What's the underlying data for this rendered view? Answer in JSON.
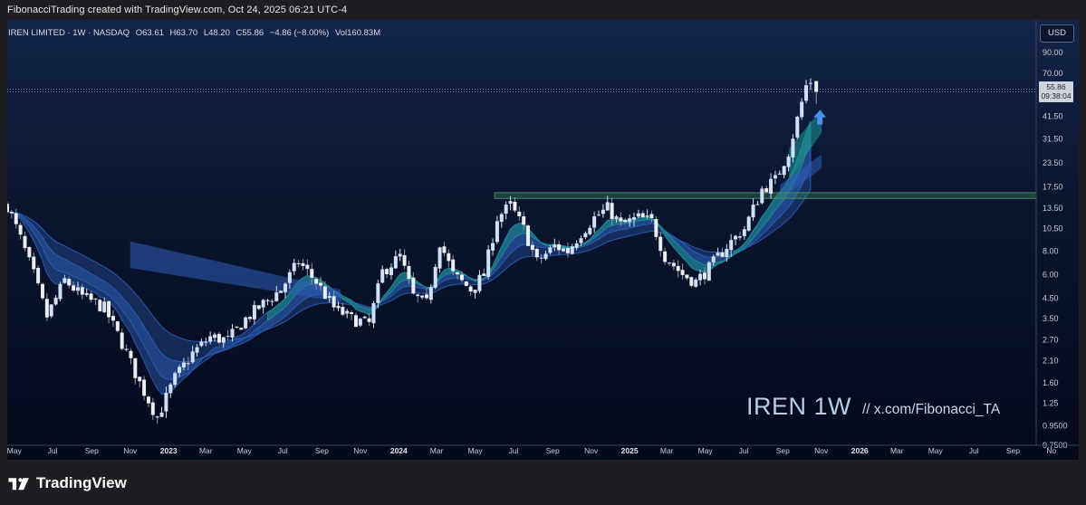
{
  "caption": "FibonacciTrading created with TradingView.com, Oct 24, 2025 06:21 UTC-4",
  "header": {
    "symbol": "IREN LIMITED · 1W · NASDAQ",
    "open": "O63.61",
    "high": "H63.70",
    "low": "L48.20",
    "close": "C55.86",
    "change": "−4.86 (−8.00%)",
    "volume": "Vol160.83M"
  },
  "currency": "USD",
  "price_label": {
    "price": "55.86",
    "countdown": "09:38:04"
  },
  "watermark": {
    "ticker": "IREN 1W",
    "handle": "//  x.com/Fibonacci_TA"
  },
  "brand": {
    "name": "TradingView",
    "icon": "tradingview-logo-icon"
  },
  "colors": {
    "candle_up": "#cfe0f7",
    "candle_down": "#8f97ab",
    "ribbon_blue": "#2e5fb8",
    "ribbon_teal": "#1c8c8f",
    "resistance": "#3f8f62",
    "arrow": "#4a8fe8",
    "axis_text": "#c7cbd6"
  },
  "chart_data": {
    "type": "candlestick",
    "interval": "1W",
    "y_scale": "log",
    "ylim": [
      0.7,
      110
    ],
    "xlim": [
      "2022-04-20",
      "2026-12-10"
    ],
    "y_ticks": [
      "90.00",
      "70.00",
      "41.50",
      "31.50",
      "23.50",
      "17.50",
      "13.50",
      "10.50",
      "8.00",
      "6.00",
      "4.50",
      "3.50",
      "2.70",
      "2.10",
      "1.60",
      "1.25",
      "0.9500",
      "0.7500"
    ],
    "x_ticks": [
      {
        "date": "2022-05-01",
        "label": "May",
        "bold": false
      },
      {
        "date": "2022-07-01",
        "label": "Jul",
        "bold": false
      },
      {
        "date": "2022-09-01",
        "label": "Sep",
        "bold": false
      },
      {
        "date": "2022-11-01",
        "label": "Nov",
        "bold": false
      },
      {
        "date": "2023-01-01",
        "label": "2023",
        "bold": true
      },
      {
        "date": "2023-03-01",
        "label": "Mar",
        "bold": false
      },
      {
        "date": "2023-05-01",
        "label": "May",
        "bold": false
      },
      {
        "date": "2023-07-01",
        "label": "Jul",
        "bold": false
      },
      {
        "date": "2023-09-01",
        "label": "Sep",
        "bold": false
      },
      {
        "date": "2023-11-01",
        "label": "Nov",
        "bold": false
      },
      {
        "date": "2024-01-01",
        "label": "2024",
        "bold": true
      },
      {
        "date": "2024-03-01",
        "label": "Mar",
        "bold": false
      },
      {
        "date": "2024-05-01",
        "label": "May",
        "bold": false
      },
      {
        "date": "2024-07-01",
        "label": "Jul",
        "bold": false
      },
      {
        "date": "2024-09-01",
        "label": "Sep",
        "bold": false
      },
      {
        "date": "2024-11-01",
        "label": "Nov",
        "bold": false
      },
      {
        "date": "2025-01-01",
        "label": "2025",
        "bold": true
      },
      {
        "date": "2025-03-01",
        "label": "Mar",
        "bold": false
      },
      {
        "date": "2025-05-01",
        "label": "May",
        "bold": false
      },
      {
        "date": "2025-07-01",
        "label": "Jul",
        "bold": false
      },
      {
        "date": "2025-09-01",
        "label": "Sep",
        "bold": false
      },
      {
        "date": "2025-11-01",
        "label": "Nov",
        "bold": false
      },
      {
        "date": "2026-01-01",
        "label": "2026",
        "bold": true
      },
      {
        "date": "2026-03-01",
        "label": "Mar",
        "bold": false
      },
      {
        "date": "2026-05-01",
        "label": "May",
        "bold": false
      },
      {
        "date": "2026-07-01",
        "label": "Jul",
        "bold": false
      },
      {
        "date": "2026-09-01",
        "label": "Sep",
        "bold": false
      },
      {
        "date": "2026-11-01",
        "label": "No",
        "bold": false
      }
    ],
    "close_anchors": [
      [
        "2022-04-20",
        14.0
      ],
      [
        "2022-05-10",
        9.5
      ],
      [
        "2022-06-01",
        6.0
      ],
      [
        "2022-06-22",
        3.6
      ],
      [
        "2022-07-20",
        5.6
      ],
      [
        "2022-08-17",
        4.6
      ],
      [
        "2022-09-21",
        4.0
      ],
      [
        "2022-10-19",
        2.6
      ],
      [
        "2022-11-16",
        1.6
      ],
      [
        "2022-12-14",
        1.05
      ],
      [
        "2023-01-11",
        1.7
      ],
      [
        "2023-02-08",
        2.3
      ],
      [
        "2023-03-08",
        2.8
      ],
      [
        "2023-04-05",
        2.7
      ],
      [
        "2023-05-03",
        3.5
      ],
      [
        "2023-05-31",
        4.2
      ],
      [
        "2023-06-28",
        5.0
      ],
      [
        "2023-07-26",
        7.0
      ],
      [
        "2023-08-23",
        5.5
      ],
      [
        "2023-09-20",
        4.0
      ],
      [
        "2023-10-18",
        3.5
      ],
      [
        "2023-11-15",
        3.3
      ],
      [
        "2023-12-06",
        6.2
      ],
      [
        "2024-01-03",
        7.5
      ],
      [
        "2024-01-24",
        4.6
      ],
      [
        "2024-02-14",
        4.2
      ],
      [
        "2024-03-06",
        9.0
      ],
      [
        "2024-03-27",
        6.0
      ],
      [
        "2024-04-24",
        5.0
      ],
      [
        "2024-05-15",
        6.0
      ],
      [
        "2024-06-05",
        12.0
      ],
      [
        "2024-06-26",
        14.0
      ],
      [
        "2024-07-17",
        10.5
      ],
      [
        "2024-08-07",
        7.0
      ],
      [
        "2024-09-04",
        8.5
      ],
      [
        "2024-09-25",
        8.0
      ],
      [
        "2024-10-16",
        10.0
      ],
      [
        "2024-11-06",
        12.0
      ],
      [
        "2024-11-27",
        13.5
      ],
      [
        "2024-12-18",
        11.0
      ],
      [
        "2025-01-15",
        12.0
      ],
      [
        "2025-02-05",
        11.5
      ],
      [
        "2025-02-26",
        7.5
      ],
      [
        "2025-03-26",
        6.0
      ],
      [
        "2025-04-16",
        5.5
      ],
      [
        "2025-05-07",
        6.5
      ],
      [
        "2025-06-04",
        8.5
      ],
      [
        "2025-07-02",
        10.5
      ],
      [
        "2025-07-30",
        17.0
      ],
      [
        "2025-08-20",
        19.0
      ],
      [
        "2025-09-10",
        27.0
      ],
      [
        "2025-09-24",
        40.0
      ],
      [
        "2025-10-08",
        60.0
      ],
      [
        "2025-10-15",
        63.6
      ],
      [
        "2025-10-24",
        55.86
      ]
    ],
    "last_candle": {
      "date": "2025-10-24",
      "open": 63.61,
      "high": 63.7,
      "low": 48.2,
      "close": 55.86
    },
    "resistance_zone": {
      "from": "2024-06-01",
      "low": 15.2,
      "high": 16.3
    },
    "current_price_lines": [
      57.5,
      55.86
    ],
    "ribbons": [
      {
        "name": "",
        "color": "ribbon_blue",
        "from": "2022-04-20",
        "to": "2025-10-17",
        "fast_alpha": 0.18,
        "slow_alpha": 0.1
      },
      {
        "name": "",
        "color": "ribbon_teal",
        "from": "2023-06-01",
        "to": "2025-10-17",
        "fast_alpha": 0.35,
        "slow_alpha": 0.22
      }
    ],
    "upper_band": {
      "from": "2022-11-01",
      "to": "2023-10-01",
      "start_low": 6.5,
      "start_high": 9.0,
      "end_low": 4.3,
      "end_high": 5.0
    },
    "arrow_marker": {
      "date": "2025-10-24",
      "price": 40.0
    }
  }
}
